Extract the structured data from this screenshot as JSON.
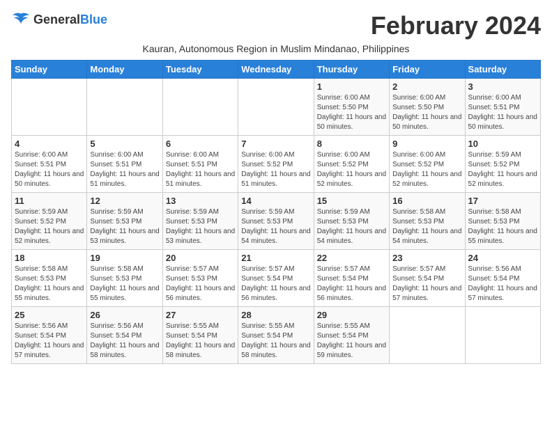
{
  "header": {
    "logo_general": "General",
    "logo_blue": "Blue",
    "month_title": "February 2024",
    "subtitle": "Kauran, Autonomous Region in Muslim Mindanao, Philippines"
  },
  "days_of_week": [
    "Sunday",
    "Monday",
    "Tuesday",
    "Wednesday",
    "Thursday",
    "Friday",
    "Saturday"
  ],
  "weeks": [
    [
      {
        "day": "",
        "sunrise": "",
        "sunset": "",
        "daylight": ""
      },
      {
        "day": "",
        "sunrise": "",
        "sunset": "",
        "daylight": ""
      },
      {
        "day": "",
        "sunrise": "",
        "sunset": "",
        "daylight": ""
      },
      {
        "day": "",
        "sunrise": "",
        "sunset": "",
        "daylight": ""
      },
      {
        "day": "1",
        "sunrise": "Sunrise: 6:00 AM",
        "sunset": "Sunset: 5:50 PM",
        "daylight": "Daylight: 11 hours and 50 minutes."
      },
      {
        "day": "2",
        "sunrise": "Sunrise: 6:00 AM",
        "sunset": "Sunset: 5:50 PM",
        "daylight": "Daylight: 11 hours and 50 minutes."
      },
      {
        "day": "3",
        "sunrise": "Sunrise: 6:00 AM",
        "sunset": "Sunset: 5:51 PM",
        "daylight": "Daylight: 11 hours and 50 minutes."
      }
    ],
    [
      {
        "day": "4",
        "sunrise": "Sunrise: 6:00 AM",
        "sunset": "Sunset: 5:51 PM",
        "daylight": "Daylight: 11 hours and 50 minutes."
      },
      {
        "day": "5",
        "sunrise": "Sunrise: 6:00 AM",
        "sunset": "Sunset: 5:51 PM",
        "daylight": "Daylight: 11 hours and 51 minutes."
      },
      {
        "day": "6",
        "sunrise": "Sunrise: 6:00 AM",
        "sunset": "Sunset: 5:51 PM",
        "daylight": "Daylight: 11 hours and 51 minutes."
      },
      {
        "day": "7",
        "sunrise": "Sunrise: 6:00 AM",
        "sunset": "Sunset: 5:52 PM",
        "daylight": "Daylight: 11 hours and 51 minutes."
      },
      {
        "day": "8",
        "sunrise": "Sunrise: 6:00 AM",
        "sunset": "Sunset: 5:52 PM",
        "daylight": "Daylight: 11 hours and 52 minutes."
      },
      {
        "day": "9",
        "sunrise": "Sunrise: 6:00 AM",
        "sunset": "Sunset: 5:52 PM",
        "daylight": "Daylight: 11 hours and 52 minutes."
      },
      {
        "day": "10",
        "sunrise": "Sunrise: 5:59 AM",
        "sunset": "Sunset: 5:52 PM",
        "daylight": "Daylight: 11 hours and 52 minutes."
      }
    ],
    [
      {
        "day": "11",
        "sunrise": "Sunrise: 5:59 AM",
        "sunset": "Sunset: 5:52 PM",
        "daylight": "Daylight: 11 hours and 52 minutes."
      },
      {
        "day": "12",
        "sunrise": "Sunrise: 5:59 AM",
        "sunset": "Sunset: 5:53 PM",
        "daylight": "Daylight: 11 hours and 53 minutes."
      },
      {
        "day": "13",
        "sunrise": "Sunrise: 5:59 AM",
        "sunset": "Sunset: 5:53 PM",
        "daylight": "Daylight: 11 hours and 53 minutes."
      },
      {
        "day": "14",
        "sunrise": "Sunrise: 5:59 AM",
        "sunset": "Sunset: 5:53 PM",
        "daylight": "Daylight: 11 hours and 54 minutes."
      },
      {
        "day": "15",
        "sunrise": "Sunrise: 5:59 AM",
        "sunset": "Sunset: 5:53 PM",
        "daylight": "Daylight: 11 hours and 54 minutes."
      },
      {
        "day": "16",
        "sunrise": "Sunrise: 5:58 AM",
        "sunset": "Sunset: 5:53 PM",
        "daylight": "Daylight: 11 hours and 54 minutes."
      },
      {
        "day": "17",
        "sunrise": "Sunrise: 5:58 AM",
        "sunset": "Sunset: 5:53 PM",
        "daylight": "Daylight: 11 hours and 55 minutes."
      }
    ],
    [
      {
        "day": "18",
        "sunrise": "Sunrise: 5:58 AM",
        "sunset": "Sunset: 5:53 PM",
        "daylight": "Daylight: 11 hours and 55 minutes."
      },
      {
        "day": "19",
        "sunrise": "Sunrise: 5:58 AM",
        "sunset": "Sunset: 5:53 PM",
        "daylight": "Daylight: 11 hours and 55 minutes."
      },
      {
        "day": "20",
        "sunrise": "Sunrise: 5:57 AM",
        "sunset": "Sunset: 5:53 PM",
        "daylight": "Daylight: 11 hours and 56 minutes."
      },
      {
        "day": "21",
        "sunrise": "Sunrise: 5:57 AM",
        "sunset": "Sunset: 5:54 PM",
        "daylight": "Daylight: 11 hours and 56 minutes."
      },
      {
        "day": "22",
        "sunrise": "Sunrise: 5:57 AM",
        "sunset": "Sunset: 5:54 PM",
        "daylight": "Daylight: 11 hours and 56 minutes."
      },
      {
        "day": "23",
        "sunrise": "Sunrise: 5:57 AM",
        "sunset": "Sunset: 5:54 PM",
        "daylight": "Daylight: 11 hours and 57 minutes."
      },
      {
        "day": "24",
        "sunrise": "Sunrise: 5:56 AM",
        "sunset": "Sunset: 5:54 PM",
        "daylight": "Daylight: 11 hours and 57 minutes."
      }
    ],
    [
      {
        "day": "25",
        "sunrise": "Sunrise: 5:56 AM",
        "sunset": "Sunset: 5:54 PM",
        "daylight": "Daylight: 11 hours and 57 minutes."
      },
      {
        "day": "26",
        "sunrise": "Sunrise: 5:56 AM",
        "sunset": "Sunset: 5:54 PM",
        "daylight": "Daylight: 11 hours and 58 minutes."
      },
      {
        "day": "27",
        "sunrise": "Sunrise: 5:55 AM",
        "sunset": "Sunset: 5:54 PM",
        "daylight": "Daylight: 11 hours and 58 minutes."
      },
      {
        "day": "28",
        "sunrise": "Sunrise: 5:55 AM",
        "sunset": "Sunset: 5:54 PM",
        "daylight": "Daylight: 11 hours and 58 minutes."
      },
      {
        "day": "29",
        "sunrise": "Sunrise: 5:55 AM",
        "sunset": "Sunset: 5:54 PM",
        "daylight": "Daylight: 11 hours and 59 minutes."
      },
      {
        "day": "",
        "sunrise": "",
        "sunset": "",
        "daylight": ""
      },
      {
        "day": "",
        "sunrise": "",
        "sunset": "",
        "daylight": ""
      }
    ]
  ]
}
